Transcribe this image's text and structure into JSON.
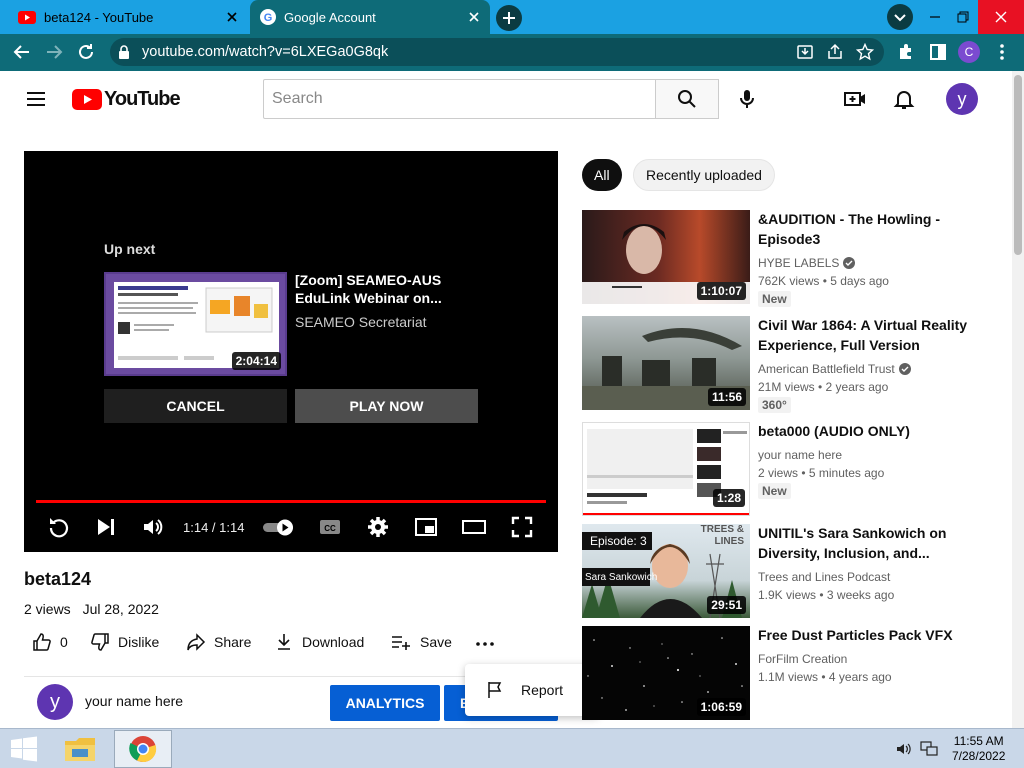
{
  "browser": {
    "tabs": [
      {
        "title": "beta124 - YouTube",
        "active": false
      },
      {
        "title": "Google Account",
        "active": true
      }
    ],
    "address": "youtube.com/watch?v=6LXEGa0G8qk",
    "profile_initial": "C"
  },
  "youtube": {
    "logo_text": "YouTube",
    "search_placeholder": "Search",
    "avatar_initial": "y"
  },
  "player": {
    "up_next_label": "Up next",
    "up_next": {
      "title": "[Zoom] SEAMEO-AUS EduLink Webinar on...",
      "channel": "SEAMEO Secretariat",
      "duration": "2:04:14"
    },
    "cancel_label": "CANCEL",
    "play_now_label": "PLAY NOW",
    "time": "1:14 / 1:14",
    "progress_fraction": 1.0
  },
  "video": {
    "title": "beta124",
    "views": "2 views",
    "date": "Jul 28, 2022",
    "likes": "0",
    "dislike_label": "Dislike",
    "share_label": "Share",
    "download_label": "Download",
    "save_label": "Save"
  },
  "channel_bar": {
    "avatar_initial": "y",
    "name": "your name here",
    "analytics_label": "ANALYTICS",
    "edit_label_fragment": "E"
  },
  "menu": {
    "report_label": "Report"
  },
  "chips": [
    "All",
    "Recently uploaded"
  ],
  "recommendations": [
    {
      "title": "&AUDITION - The Howling - Episode3",
      "channel": "HYBE LABELS",
      "verified": true,
      "views": "762K views • 5 days ago",
      "badge": "New",
      "duration": "1:10:07"
    },
    {
      "title": "Civil War 1864: A Virtual Reality Experience, Full Version",
      "channel": "American Battlefield Trust",
      "verified": true,
      "views": "21M views • 2 years ago",
      "badge": "360°",
      "duration": "11:56"
    },
    {
      "title": "beta000 (AUDIO ONLY)",
      "channel": "your name here",
      "verified": false,
      "views": "2 views • 5 minutes ago",
      "badge": "New",
      "duration": "1:28"
    },
    {
      "title": "UNITIL's Sara Sankowich on Diversity, Inclusion, and...",
      "channel": "Trees and Lines Podcast",
      "verified": false,
      "views": "1.9K views • 3 weeks ago",
      "badge": "",
      "duration": "29:51",
      "thumb_text": [
        "Episode: 3",
        "Sara Sankowich",
        "TREES &",
        "LINES"
      ]
    },
    {
      "title": "Free Dust Particles Pack VFX",
      "channel": "ForFilm Creation",
      "verified": false,
      "views": "1.1M views • 4 years ago",
      "badge": "",
      "duration": "1:06:59"
    }
  ],
  "taskbar": {
    "time": "11:55 AM",
    "date": "7/28/2022"
  },
  "colors": {
    "chrome_tab_strip": "#1ba1e2",
    "chrome_toolbar": "#0e6b78",
    "yt_red": "#ff0000",
    "yt_blue": "#065fd4",
    "avatar_purple": "#5e35b1"
  }
}
